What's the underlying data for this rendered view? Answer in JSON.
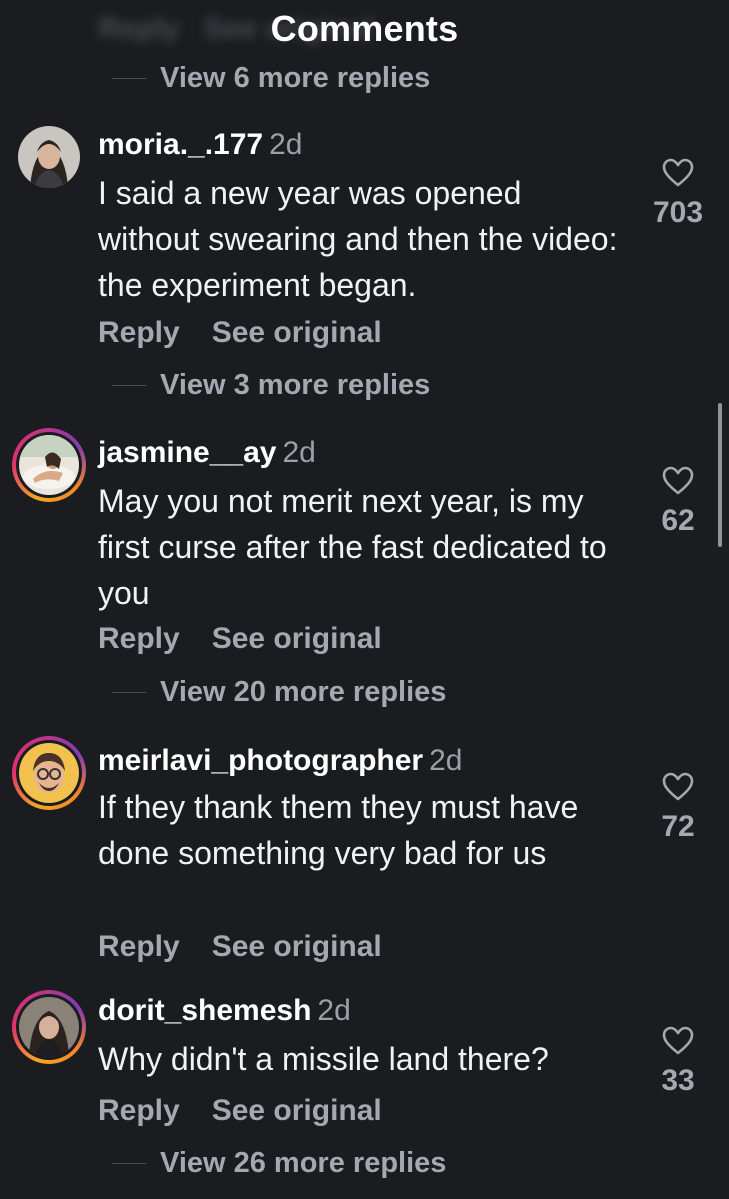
{
  "header": {
    "title": "Comments",
    "ghost_reply": "Reply",
    "ghost_see": "See original"
  },
  "top_thread": {
    "view_more": "View 6 more replies"
  },
  "comments": [
    {
      "username": "moria._.177",
      "time": "2d",
      "text": "I said a new year was opened without swearing and then the video: the experiment began.",
      "reply": "Reply",
      "see_original": "See original",
      "likes": "703",
      "view_more": "View 3 more replies"
    },
    {
      "username": "jasmine__ay",
      "time": "2d",
      "text": "May you not merit next year, is my first curse after the fast dedicated to you",
      "reply": "Reply",
      "see_original": "See original",
      "likes": "62",
      "view_more": "View 20 more replies"
    },
    {
      "username": "meirlavi_photographer",
      "time": "2d",
      "text": "If they thank them they must have done something very bad for us",
      "reply": "Reply",
      "see_original": "See original",
      "likes": "72",
      "view_more": ""
    },
    {
      "username": "dorit_shemesh",
      "time": "2d",
      "text": "Why didn't a missile land there?",
      "reply": "Reply",
      "see_original": "See original",
      "likes": "33",
      "view_more": "View 26 more replies"
    }
  ],
  "icons": {
    "like": "heart-outline-icon",
    "avatar_ring": "story-ring"
  },
  "colors": {
    "background": "#1a1c20",
    "text_primary": "#f2f2f2",
    "text_secondary": "#a4a8b0",
    "ring_gradient": [
      "#f5a623",
      "#e1306c",
      "#833ab4"
    ]
  }
}
